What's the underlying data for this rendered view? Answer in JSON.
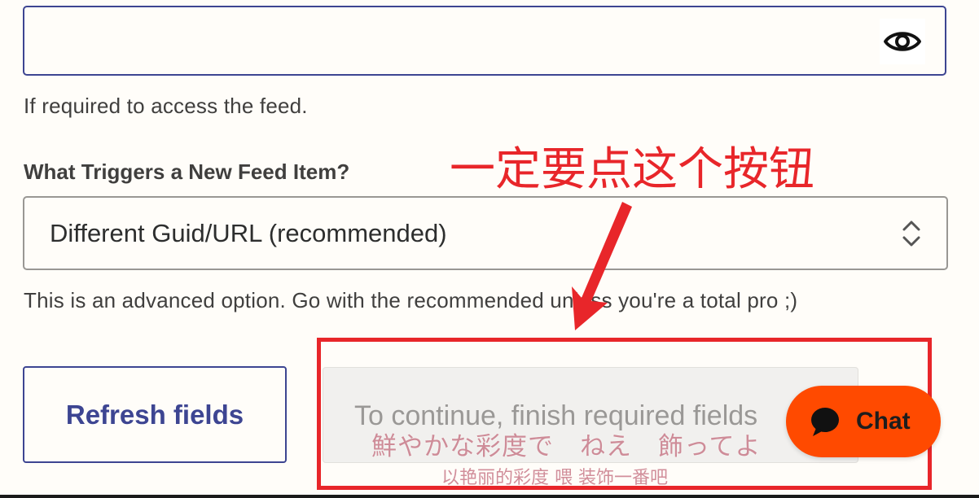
{
  "password_field": {
    "value": "",
    "help_text": "If required to access the feed."
  },
  "trigger": {
    "label": "What Triggers a New Feed Item?",
    "selected": "Different Guid/URL (recommended)",
    "help_text": "This is an advanced option. Go with the recommended unless you're a total pro ;)"
  },
  "buttons": {
    "refresh": "Refresh fields",
    "continue": "To continue, finish required fields"
  },
  "chat": {
    "label": "Chat"
  },
  "annotation": {
    "note": "一定要点这个按钮",
    "color": "#e8262a"
  },
  "subtitles": {
    "line1": "鮮やかな彩度で　ねえ　飾ってよ",
    "line2": "以艳丽的彩度 喂 装饰一番吧"
  },
  "colors": {
    "brand": "#3d4592",
    "chat": "#ff4a00",
    "background": "#fffdf9"
  }
}
